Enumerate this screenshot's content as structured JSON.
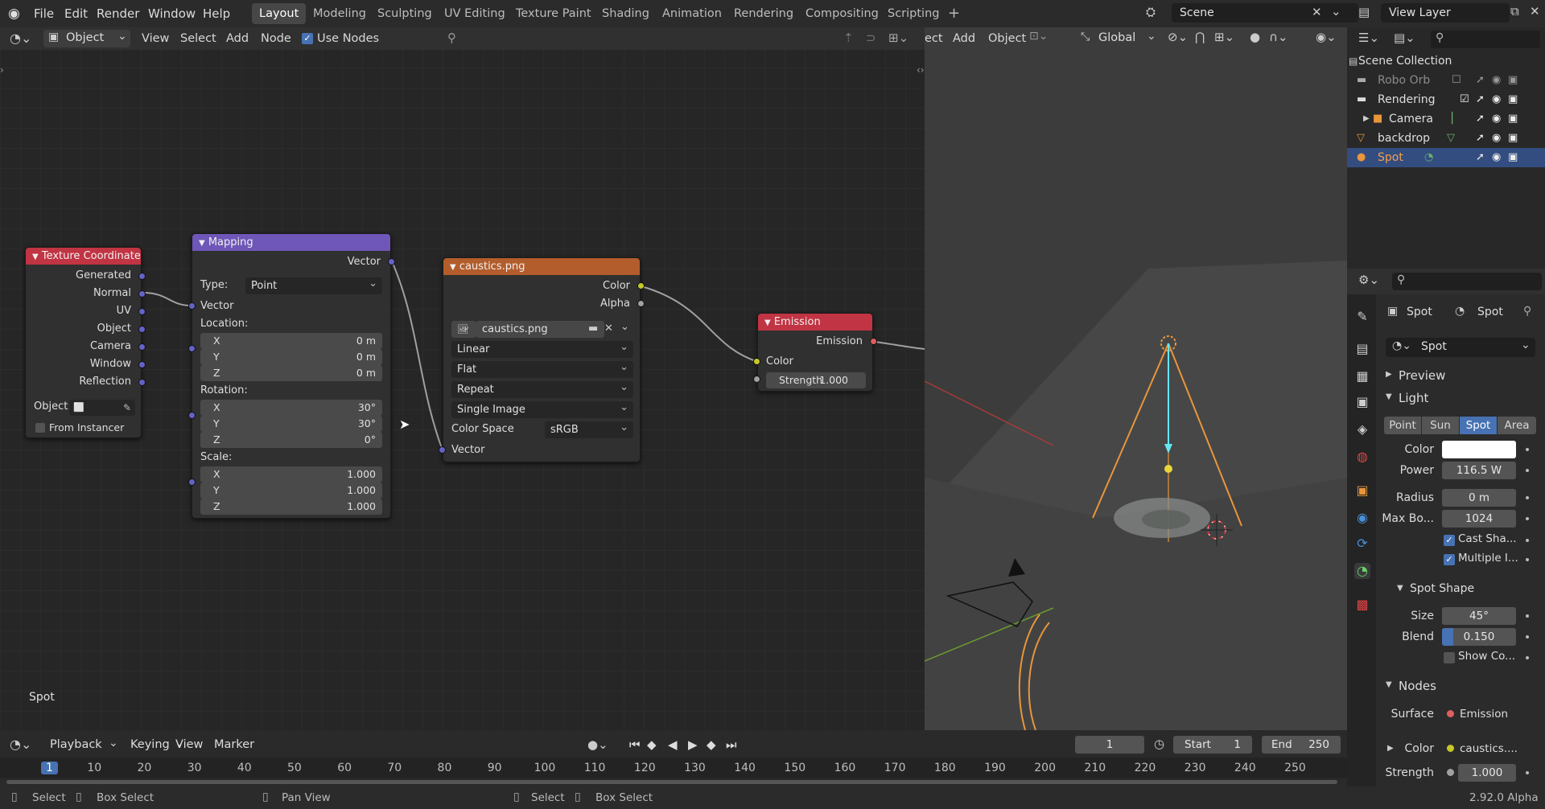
{
  "menu": [
    "File",
    "Edit",
    "Render",
    "Window",
    "Help"
  ],
  "workspaces": [
    "Layout",
    "Modeling",
    "Sculpting",
    "UV Editing",
    "Texture Paint",
    "Shading",
    "Animation",
    "Rendering",
    "Compositing",
    "Scripting"
  ],
  "active_workspace": "Layout",
  "scene": "Scene",
  "view_layer": "View Layer",
  "node_header": {
    "mode": "Object",
    "menus": [
      "View",
      "Select",
      "Add",
      "Node"
    ],
    "use_nodes": "Use Nodes"
  },
  "viewport_header": {
    "menus": [
      "ect",
      "Add",
      "Object"
    ],
    "transform": "Global"
  },
  "nodes": {
    "texcoord": {
      "title": "Texture Coordinate",
      "outputs": [
        "Generated",
        "Normal",
        "UV",
        "Object",
        "Camera",
        "Window",
        "Reflection"
      ],
      "object_label": "Object:",
      "from_instancer": "From Instancer"
    },
    "mapping": {
      "title": "Mapping",
      "output": "Vector",
      "type_label": "Type:",
      "type_value": "Point",
      "input": "Vector",
      "location_label": "Location:",
      "location": [
        {
          "axis": "X",
          "value": "0 m"
        },
        {
          "axis": "Y",
          "value": "0 m"
        },
        {
          "axis": "Z",
          "value": "0 m"
        }
      ],
      "rotation_label": "Rotation:",
      "rotation": [
        {
          "axis": "X",
          "value": "30°"
        },
        {
          "axis": "Y",
          "value": "30°"
        },
        {
          "axis": "Z",
          "value": "0°"
        }
      ],
      "scale_label": "Scale:",
      "scale": [
        {
          "axis": "X",
          "value": "1.000"
        },
        {
          "axis": "Y",
          "value": "1.000"
        },
        {
          "axis": "Z",
          "value": "1.000"
        }
      ]
    },
    "image": {
      "title": "caustics.png",
      "out_color": "Color",
      "out_alpha": "Alpha",
      "image_name": "caustics.png",
      "interpolation": "Linear",
      "projection": "Flat",
      "extension": "Repeat",
      "source": "Single Image",
      "color_space_label": "Color Space",
      "color_space": "sRGB",
      "input": "Vector"
    },
    "emission": {
      "title": "Emission",
      "output": "Emission",
      "in_color": "Color",
      "strength_label": "Strength",
      "strength": "1.000"
    }
  },
  "node_editor_label": "Spot",
  "outliner": {
    "title": "Scene Collection",
    "items": [
      {
        "name": "Robo Orb"
      },
      {
        "name": "Rendering"
      },
      {
        "name": "Camera"
      },
      {
        "name": "backdrop"
      },
      {
        "name": "Spot"
      }
    ]
  },
  "properties": {
    "breadcrumb_obj": "Spot",
    "breadcrumb_data": "Spot",
    "datablock": "Spot",
    "preview": "Preview",
    "light": "Light",
    "light_types": [
      "Point",
      "Sun",
      "Spot",
      "Area"
    ],
    "active_light_type": "Spot",
    "color_label": "Color",
    "power_label": "Power",
    "power": "116.5 W",
    "radius_label": "Radius",
    "radius": "0 m",
    "maxbounce_label": "Max Bo...",
    "maxbounce": "1024",
    "cast_shadow": "Cast Sha...",
    "multiple": "Multiple I...",
    "spot_shape": "Spot Shape",
    "size_label": "Size",
    "size": "45°",
    "blend_label": "Blend",
    "blend": "0.150",
    "blend_fraction": 0.15,
    "show_cone": "Show Co...",
    "nodes": "Nodes",
    "surface_label": "Surface",
    "surface": "Emission",
    "ncolor_label": "Color",
    "ncolor": "caustics....",
    "nstrength_label": "Strength",
    "nstrength": "1.000"
  },
  "timeline": {
    "menus": [
      "Playback",
      "Keying",
      "View",
      "Marker"
    ],
    "current_frame": "1",
    "start_label": "Start",
    "start": "1",
    "end_label": "End",
    "end": "250",
    "ticks": [
      "1",
      "10",
      "20",
      "30",
      "40",
      "50",
      "60",
      "70",
      "80",
      "90",
      "100",
      "110",
      "120",
      "130",
      "140",
      "150",
      "160",
      "170",
      "180",
      "190",
      "200",
      "210",
      "220",
      "230",
      "240",
      "250"
    ]
  },
  "statusbar": {
    "items": [
      "Select",
      "Box Select",
      "Pan View",
      "Select",
      "Box Select"
    ],
    "version": "2.92.0 Alpha"
  }
}
